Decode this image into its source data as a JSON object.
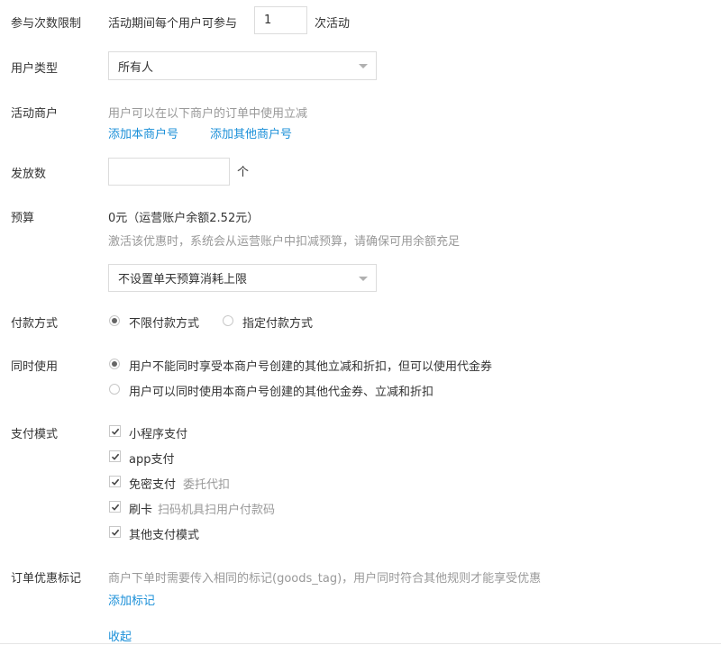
{
  "participation": {
    "label": "参与次数限制",
    "prefix": "活动期间每个用户可参与",
    "value": "1",
    "suffix": "次活动"
  },
  "user_type": {
    "label": "用户类型",
    "selected": "所有人"
  },
  "merchant": {
    "label": "活动商户",
    "hint": "用户可以在以下商户的订单中使用立减",
    "add_own": "添加本商户号",
    "add_other": "添加其他商户号"
  },
  "issue_count": {
    "label": "发放数",
    "value": "",
    "unit": "个"
  },
  "budget": {
    "label": "预算",
    "amount": "0元（运营账户余额2.52元）",
    "hint": "激活该优惠时，系统会从运营账户中扣减预算，请确保可用余额充足",
    "daily_limit_selected": "不设置单天预算消耗上限"
  },
  "payment_method": {
    "label": "付款方式",
    "options": [
      "不限付款方式",
      "指定付款方式"
    ],
    "selected_index": 0
  },
  "concurrent_use": {
    "label": "同时使用",
    "options": [
      "用户不能同时享受本商户号创建的其他立减和折扣，但可以使用代金券",
      "用户可以同时使用本商户号创建的其他代金券、立减和折扣"
    ],
    "selected_index": 0
  },
  "pay_mode": {
    "label": "支付模式",
    "items": [
      {
        "label": "小程序支付",
        "note": "",
        "checked": true
      },
      {
        "label": "app支付",
        "note": "",
        "checked": true
      },
      {
        "label": "免密支付",
        "note": "委托代扣",
        "checked": true
      },
      {
        "label": "刷卡",
        "note": "扫码机具扫用户付款码",
        "checked": true
      },
      {
        "label": "其他支付模式",
        "note": "",
        "checked": true
      }
    ]
  },
  "order_tag": {
    "label": "订单优惠标记",
    "hint": "商户下单时需要传入相同的标记(goods_tag)，用户同时符合其他规则才能享受优惠",
    "add_tag": "添加标记"
  },
  "collapse": "收起"
}
